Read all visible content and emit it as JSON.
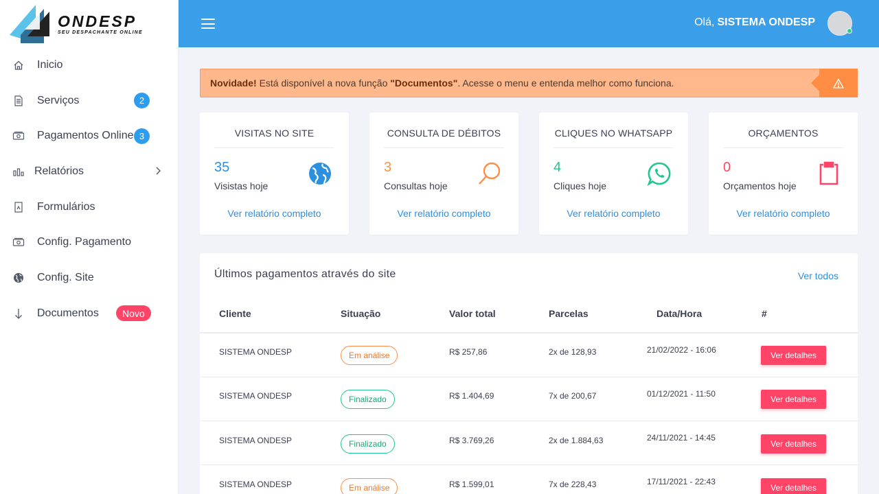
{
  "brand": {
    "name": "ONDESP",
    "tagline": "SEU DESPACHANTE ONLINE"
  },
  "sidebar": {
    "items": [
      {
        "label": "Inicio",
        "icon": "home-icon"
      },
      {
        "label": "Serviços",
        "icon": "document-icon",
        "badge": "2"
      },
      {
        "label": "Pagamentos Online",
        "icon": "money-icon",
        "badge": "3"
      },
      {
        "label": "Relatórios",
        "icon": "bar-chart-icon"
      },
      {
        "label": "Formulários",
        "icon": "form-icon"
      },
      {
        "label": "Config. Pagamento",
        "icon": "money-icon"
      },
      {
        "label": "Config. Site",
        "icon": "globe-icon"
      },
      {
        "label": "Documentos",
        "icon": "arrow-down-icon",
        "badge": "Novo"
      }
    ]
  },
  "topbar": {
    "greeting": "Olá,",
    "user": "SISTEMA ONDESP"
  },
  "alert": {
    "strong": "Novidade!",
    "text1": " Está disponível a nova função ",
    "feature": "\"Documentos\"",
    "text2": ". Acesse o menu e entenda melhor como funciona."
  },
  "cards": [
    {
      "title": "VISITAS NO SITE",
      "value": "35",
      "subtitle": "Visistas hoje",
      "link": "Ver relatório completo",
      "color": "#2c8fe0",
      "icon": "globe-icon"
    },
    {
      "title": "CONSULTA DE DÉBITOS",
      "value": "3",
      "subtitle": "Consultas hoje",
      "link": "Ver relatório completo",
      "color": "#ff8e44",
      "icon": "search-icon"
    },
    {
      "title": "CLIQUES NO WHATSAPP",
      "value": "4",
      "subtitle": "Cliques hoje",
      "link": "Ver relatório completo",
      "color": "#21c58e",
      "icon": "whatsapp-icon"
    },
    {
      "title": "ORÇAMENTOS",
      "value": "0",
      "subtitle": "Orçamentos hoje",
      "link": "Ver relatório completo",
      "color": "#ff4468",
      "icon": "clipboard-icon"
    }
  ],
  "payments": {
    "title": "Últimos pagamentos através do site",
    "view_all": "Ver todos",
    "columns": [
      "Cliente",
      "Situação",
      "Valor total",
      "Parcelas",
      "Data/Hora",
      "#"
    ],
    "rows": [
      {
        "client": "SISTEMA ONDESP",
        "status": "Em análise",
        "total": "R$ 257,86",
        "installments": "2x de 128,93",
        "datetime": "21/02/2022 - 16:06",
        "action": "Ver detalhes"
      },
      {
        "client": "SISTEMA ONDESP",
        "status": "Finalizado",
        "total": "R$ 1.404,69",
        "installments": "7x de 200,67",
        "datetime": "01/12/2021 - 11:50",
        "action": "Ver detalhes"
      },
      {
        "client": "SISTEMA ONDESP",
        "status": "Finalizado",
        "total": "R$ 3.769,26",
        "installments": "2x de 1.884,63",
        "datetime": "24/11/2021 - 14:45",
        "action": "Ver detalhes"
      },
      {
        "client": "SISTEMA ONDESP",
        "status": "Em análise",
        "total": "R$ 1.599,01",
        "installments": "7x de 228,43",
        "datetime": "17/11/2021 - 22:43",
        "action": "Ver detalhes"
      }
    ]
  }
}
